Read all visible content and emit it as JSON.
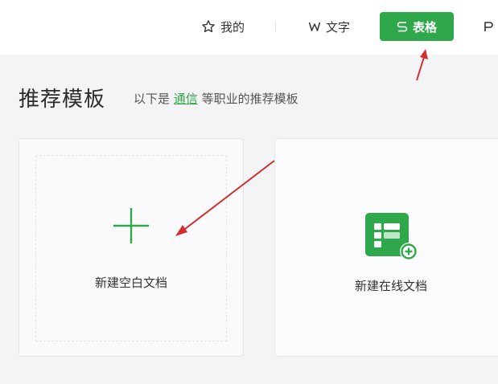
{
  "nav": {
    "tabs": [
      {
        "label": "我的",
        "icon": "star-icon"
      },
      {
        "label": "文字",
        "icon": "w-letter-icon"
      },
      {
        "label": "表格",
        "icon": "s-letter-icon",
        "active": true
      },
      {
        "label": "",
        "icon": "p-letter-icon"
      }
    ]
  },
  "section": {
    "title": "推荐模板",
    "desc_prefix": "以下是",
    "desc_link": "通信",
    "desc_suffix": "等职业的推荐模板"
  },
  "cards": {
    "blank": {
      "label": "新建空白文档",
      "icon": "plus-icon"
    },
    "online": {
      "label": "新建在线文档",
      "icon": "online-sheet-add-icon"
    }
  },
  "colors": {
    "accent": "#2ea84a",
    "annotation_arrow": "#d32f2f"
  }
}
